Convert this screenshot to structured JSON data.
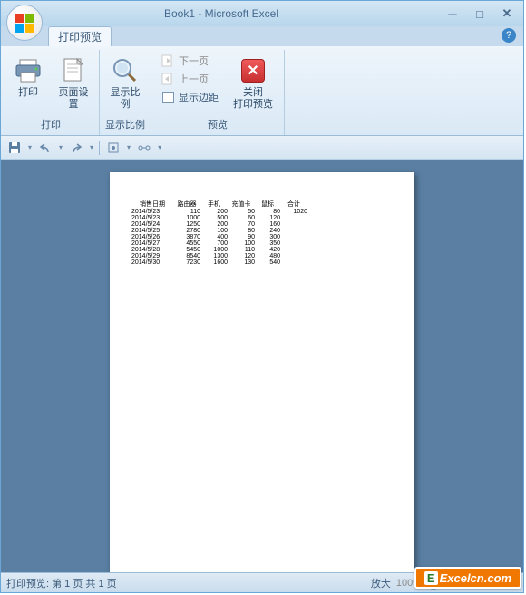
{
  "title": "Book1 - Microsoft Excel",
  "tab": "打印预览",
  "ribbon": {
    "print_group": "打印",
    "print": "打印",
    "page_setup": "页面设置",
    "zoom_group": "显示比例",
    "zoom": "显示比例",
    "preview_group": "预览",
    "next_page": "下一页",
    "prev_page": "上一页",
    "show_margins": "显示边距",
    "close_label1": "关闭",
    "close_label2": "打印预览"
  },
  "help": "?",
  "status": {
    "left": "打印预览: 第 1 页 共 1 页",
    "zoom_label": "放大",
    "zoom_pct": "100%"
  },
  "sheet": {
    "headers": [
      "销售日期",
      "路由器",
      "手机",
      "充值卡",
      "鼠标",
      "合计"
    ],
    "rows": [
      [
        "2014/5/23",
        "110",
        "200",
        "50",
        "80",
        "1020"
      ],
      [
        "2014/5/23",
        "1000",
        "500",
        "60",
        "120",
        ""
      ],
      [
        "2014/5/24",
        "1250",
        "200",
        "70",
        "160",
        ""
      ],
      [
        "2014/5/25",
        "2780",
        "100",
        "80",
        "240",
        ""
      ],
      [
        "2014/5/26",
        "3870",
        "400",
        "90",
        "300",
        ""
      ],
      [
        "2014/5/27",
        "4550",
        "700",
        "100",
        "350",
        ""
      ],
      [
        "2014/5/28",
        "5450",
        "1000",
        "110",
        "420",
        ""
      ],
      [
        "2014/5/29",
        "8540",
        "1300",
        "120",
        "480",
        ""
      ],
      [
        "2014/5/30",
        "7230",
        "1600",
        "130",
        "540",
        ""
      ]
    ]
  },
  "watermark": "Excelcn.com"
}
